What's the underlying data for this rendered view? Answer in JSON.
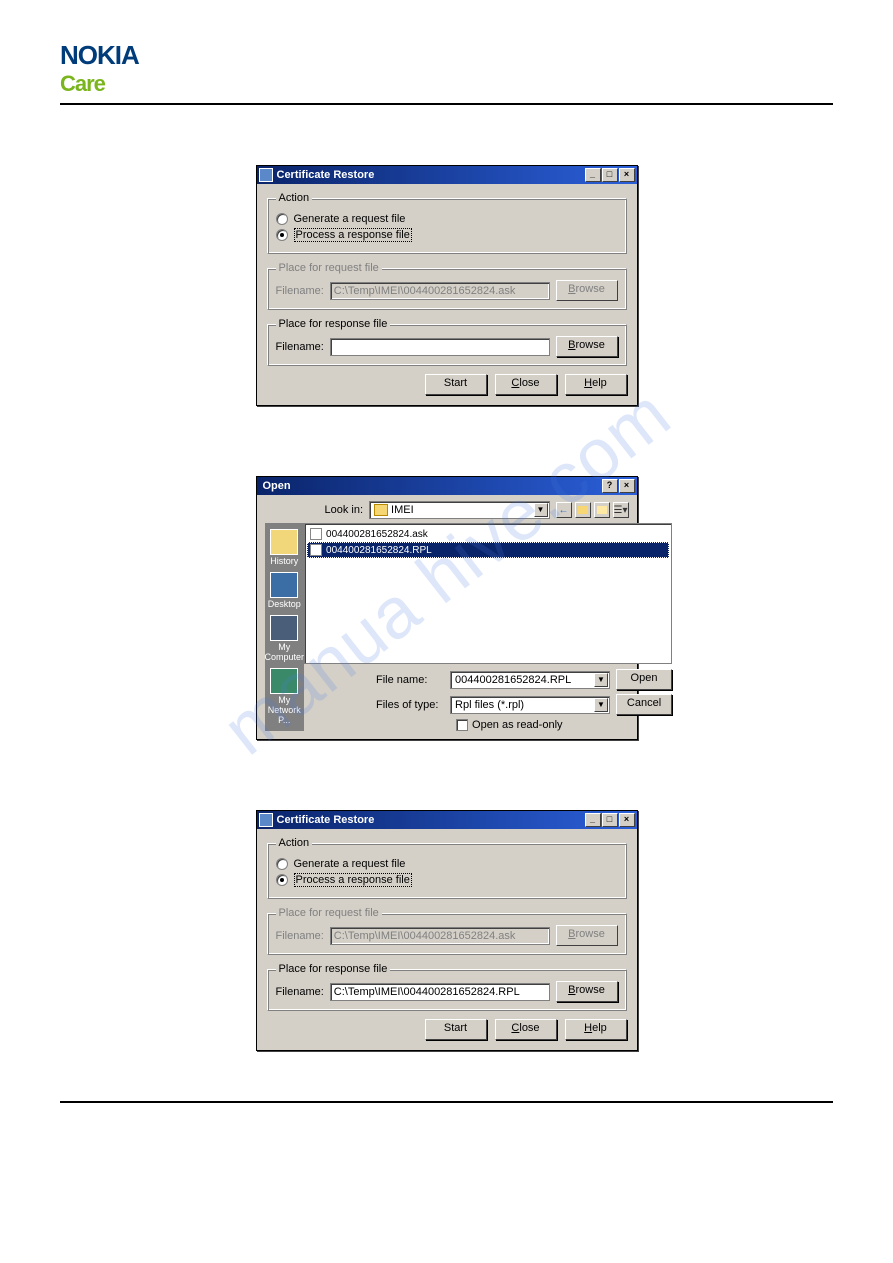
{
  "brand": {
    "nokia": "NOKIA",
    "care": "Care"
  },
  "watermark": "manua hive.com",
  "dlg1": {
    "title": "Certificate Restore",
    "action_legend": "Action",
    "radio_generate": "Generate a request file",
    "radio_process": "Process a response file",
    "request_legend": "Place for request file",
    "response_legend": "Place for response file",
    "filename_label": "Filename:",
    "request_value": "C:\\Temp\\IMEI\\004400281652824.ask",
    "response_value": "",
    "browse": "Browse",
    "start": "Start",
    "close": "Close",
    "help": "Help"
  },
  "opendlg": {
    "title": "Open",
    "lookin_label": "Look in:",
    "lookin_value": "IMEI",
    "places": {
      "history": "History",
      "desktop": "Desktop",
      "mycomputer": "My Computer",
      "network": "My Network P..."
    },
    "files": {
      "ask": "004400281652824.ask",
      "rpl": "004400281652824.RPL"
    },
    "filename_label": "File name:",
    "filename_value": "004400281652824.RPL",
    "filetype_label": "Files of type:",
    "filetype_value": "Rpl files (*.rpl)",
    "readonly": "Open as read-only",
    "open": "Open",
    "cancel": "Cancel"
  },
  "dlg3": {
    "title": "Certificate Restore",
    "action_legend": "Action",
    "radio_generate": "Generate a request file",
    "radio_process": "Process a response file",
    "request_legend": "Place for request file",
    "response_legend": "Place for response file",
    "filename_label": "Filename:",
    "request_value": "C:\\Temp\\IMEI\\004400281652824.ask",
    "response_value": "C:\\Temp\\IMEI\\004400281652824.RPL",
    "browse": "Browse",
    "start": "Start",
    "close": "Close",
    "help": "Help"
  }
}
